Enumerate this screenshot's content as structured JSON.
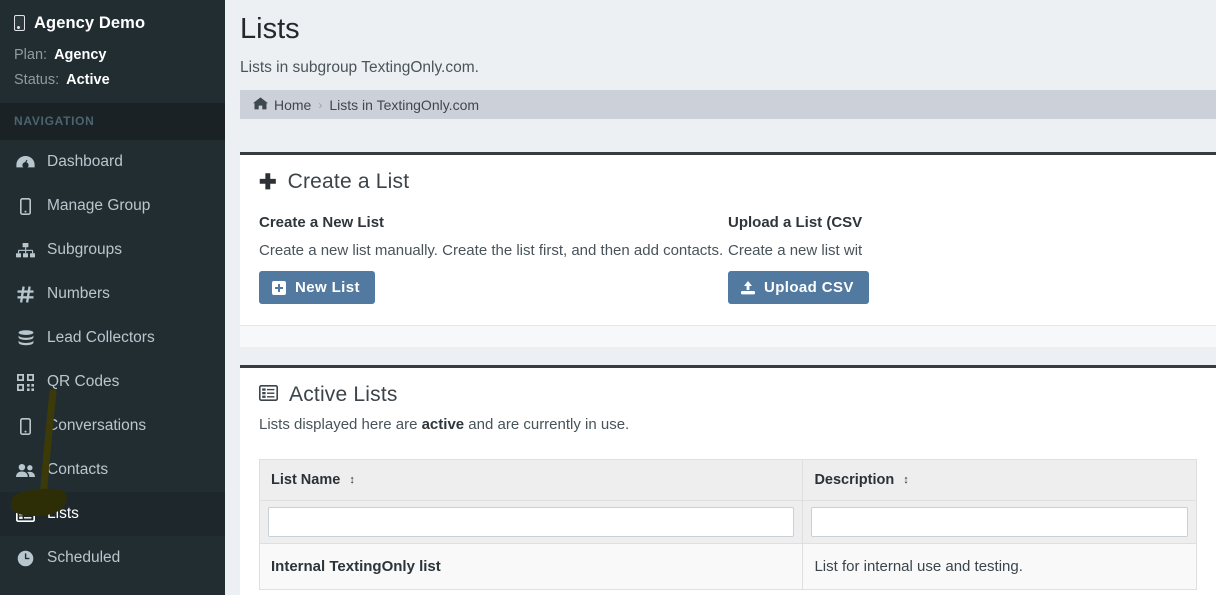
{
  "sidebar": {
    "brand": {
      "icon": "mobile-phone-icon",
      "title": "Agency Demo"
    },
    "meta": [
      {
        "key": "Plan:",
        "value": "Agency"
      },
      {
        "key": "Status:",
        "value": "Active"
      }
    ],
    "nav_header": "NAVIGATION",
    "items": [
      {
        "icon": "tachometer-icon",
        "label": "Dashboard",
        "active": false
      },
      {
        "icon": "mobile-phone-icon",
        "label": "Manage Group",
        "active": false
      },
      {
        "icon": "sitemap-icon",
        "label": "Subgroups",
        "active": false
      },
      {
        "icon": "hashtag-icon",
        "label": "Numbers",
        "active": false
      },
      {
        "icon": "database-icon",
        "label": "Lead Collectors",
        "active": false
      },
      {
        "icon": "qrcode-icon",
        "label": "QR Codes",
        "active": false
      },
      {
        "icon": "mobile-phone-icon",
        "label": "Conversations",
        "active": false
      },
      {
        "icon": "users-icon",
        "label": "Contacts",
        "active": false
      },
      {
        "icon": "list-alt-icon",
        "label": "Lists",
        "active": true
      },
      {
        "icon": "clock-icon",
        "label": "Scheduled",
        "active": false
      }
    ],
    "annotation": {
      "name": "highlighter-annotation",
      "color": "#f2e705",
      "target": "Lists"
    }
  },
  "header": {
    "title": "Lists",
    "subtitle": "Lists in subgroup TextingOnly.com."
  },
  "breadcrumb": {
    "home_icon": "home-icon",
    "home_label": "Home",
    "separator": "›",
    "current": "Lists in TextingOnly.com"
  },
  "create_panel": {
    "icon": "plus-icon",
    "title": "Create a List",
    "left": {
      "title": "Create a New List",
      "description": "Create a new list manually. Create the list first, and then add contacts.",
      "button_icon": "plus-square-icon",
      "button_label": "New List"
    },
    "right": {
      "title": "Upload a List (CSV",
      "description": "Create a new list wit",
      "button_icon": "upload-icon",
      "button_label": "Upload CSV"
    }
  },
  "lists_panel": {
    "icon": "list-alt-icon",
    "title": "Active Lists",
    "subtitle_pre": "Lists displayed here are ",
    "subtitle_bold": "active",
    "subtitle_post": " and are currently in use.",
    "table": {
      "columns": [
        {
          "label": "List Name",
          "sort_icon": "sort-icon",
          "filter_value": "",
          "filter_placeholder": ""
        },
        {
          "label": "Description",
          "sort_icon": "sort-icon",
          "filter_value": "",
          "filter_placeholder": ""
        }
      ],
      "rows": [
        {
          "name": "Internal TextingOnly list",
          "description": "List for internal use and testing."
        }
      ]
    }
  },
  "colors": {
    "sidebar_bg": "#222d32",
    "sidebar_dark": "#1a2226",
    "sidebar_active": "#1e282c",
    "page_bg": "#ecf0f3",
    "panel_border": "#353c42",
    "button_blue": "#52799f",
    "breadcrumb_bg": "#ccd1d9",
    "highlight_yellow": "#f2e705"
  }
}
